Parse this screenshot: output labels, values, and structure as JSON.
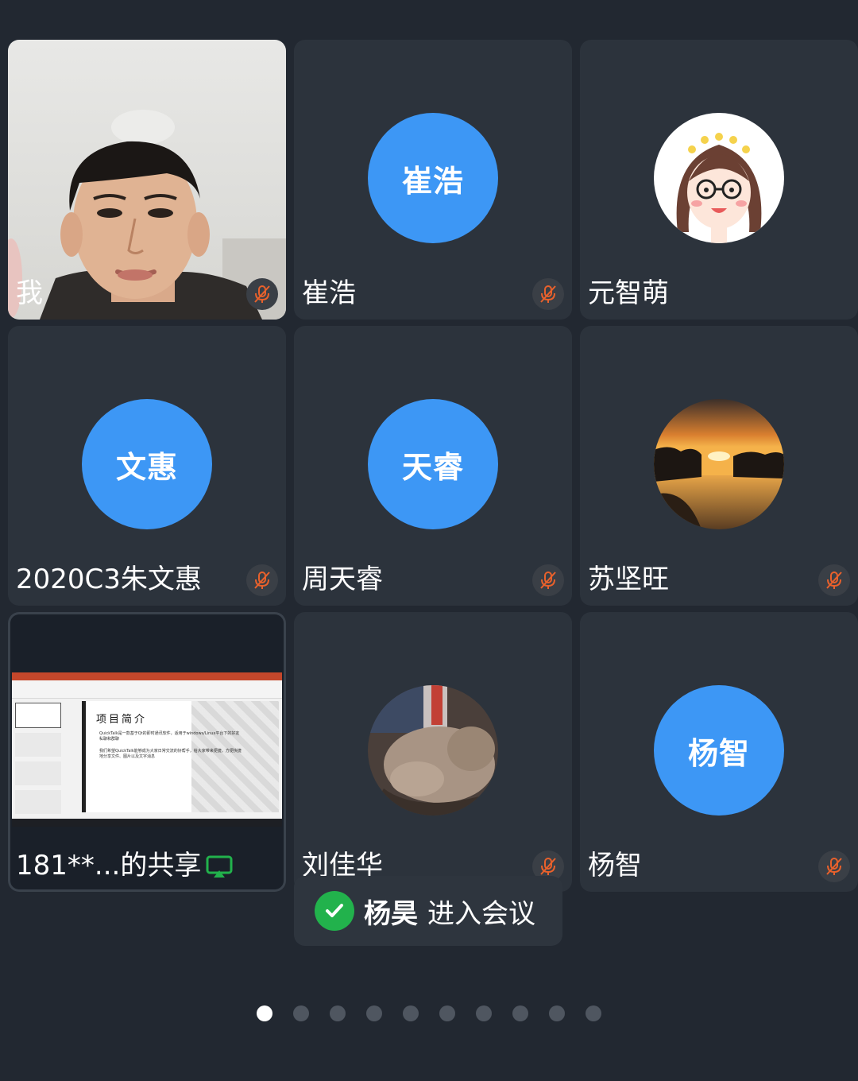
{
  "participants": [
    {
      "name": "我",
      "avatar_type": "camera",
      "muted": true,
      "active": true
    },
    {
      "name": "崔浩",
      "avatar_type": "initials",
      "initials": "崔浩",
      "muted": true
    },
    {
      "name": "元智萌",
      "avatar_type": "cartoon-girl",
      "muted": false
    },
    {
      "name": "2020C3朱文惠",
      "avatar_type": "initials",
      "initials": "文惠",
      "muted": true
    },
    {
      "name": "周天睿",
      "avatar_type": "initials",
      "initials": "天睿",
      "muted": true
    },
    {
      "name": "苏坚旺",
      "avatar_type": "sunset-photo",
      "muted": true
    },
    {
      "name": "181**...的共享",
      "avatar_type": "screen-share",
      "muted": false
    },
    {
      "name": "刘佳华",
      "avatar_type": "dog-photo",
      "muted": true
    },
    {
      "name": "杨智",
      "avatar_type": "initials",
      "initials": "杨智",
      "muted": true
    }
  ],
  "shared_slide": {
    "title": "项目简介",
    "bullets": [
      "QuickTalk是一款基于Qt的即时通讯软件，适用于windows/Linux平台下的好友私聊和群聊",
      "我们希望QuickTalk能够成为大家日常交流的好帮手，给大家带来便捷，方便快捷地分享文件、图片以及文字消息"
    ]
  },
  "toast": {
    "name": "杨昊",
    "message": "进入会议",
    "icon": "check-icon"
  },
  "pagination": {
    "total": 10,
    "current": 1
  },
  "colors": {
    "background": "#222831",
    "tile": "#2c333c",
    "avatar_blue": "#3d97f5",
    "muted_red": "#e8612c",
    "share_green": "#22b24c"
  }
}
